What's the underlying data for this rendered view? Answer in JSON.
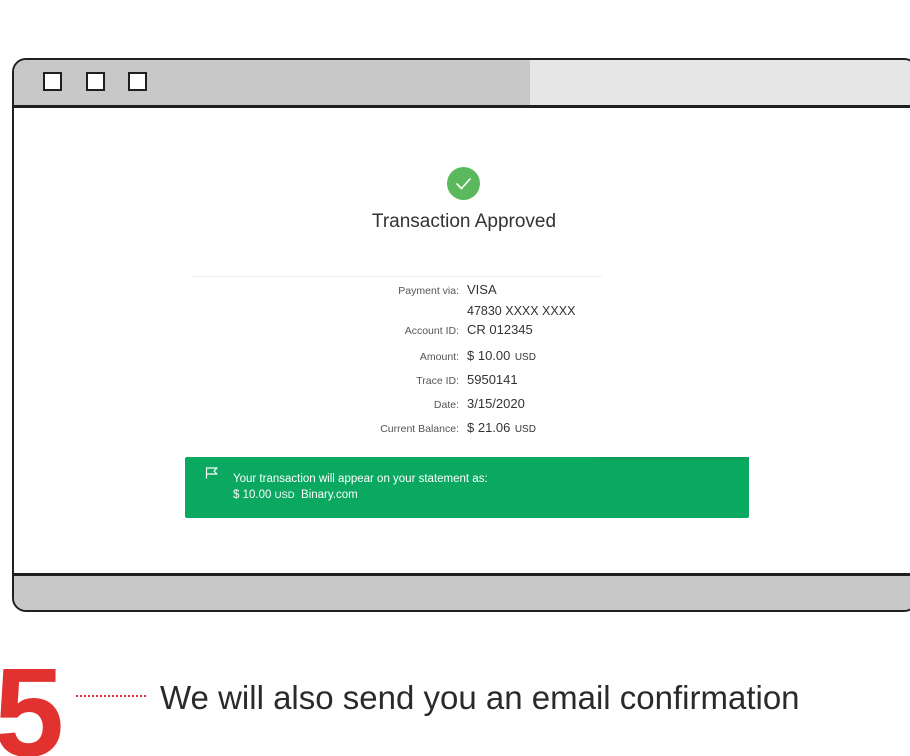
{
  "window": {
    "buttons": [
      "",
      "",
      ""
    ]
  },
  "receipt": {
    "title": "Transaction Approved",
    "payment_label": "Payment via:",
    "payment_value": "VISA",
    "card_number": "47830 XXXX XXXX",
    "account_label": "Account ID:",
    "account_value": "CR 012345",
    "amount_label": "Amount:",
    "amount_value": "$ 10.00",
    "amount_currency": "USD",
    "trace_label": "Trace ID:",
    "trace_value": "5950141",
    "date_label": "Date:",
    "date_value": "3/15/2020",
    "balance_label": "Current Balance:",
    "balance_value": "$ 21.06",
    "balance_currency": "USD"
  },
  "banner": {
    "line1": "Your transaction will appear on your statement as:",
    "amount": "$ 10.00",
    "currency": "USD",
    "merchant": "Binary.com"
  },
  "step": {
    "number": "5",
    "text": "We will also send you an email confirmation"
  },
  "colors": {
    "success_green": "#0aa860",
    "check_green": "#5cb85c",
    "step_red": "#e2322f"
  },
  "icons": {
    "approved": "check-circle-icon",
    "banner": "flag-icon"
  }
}
